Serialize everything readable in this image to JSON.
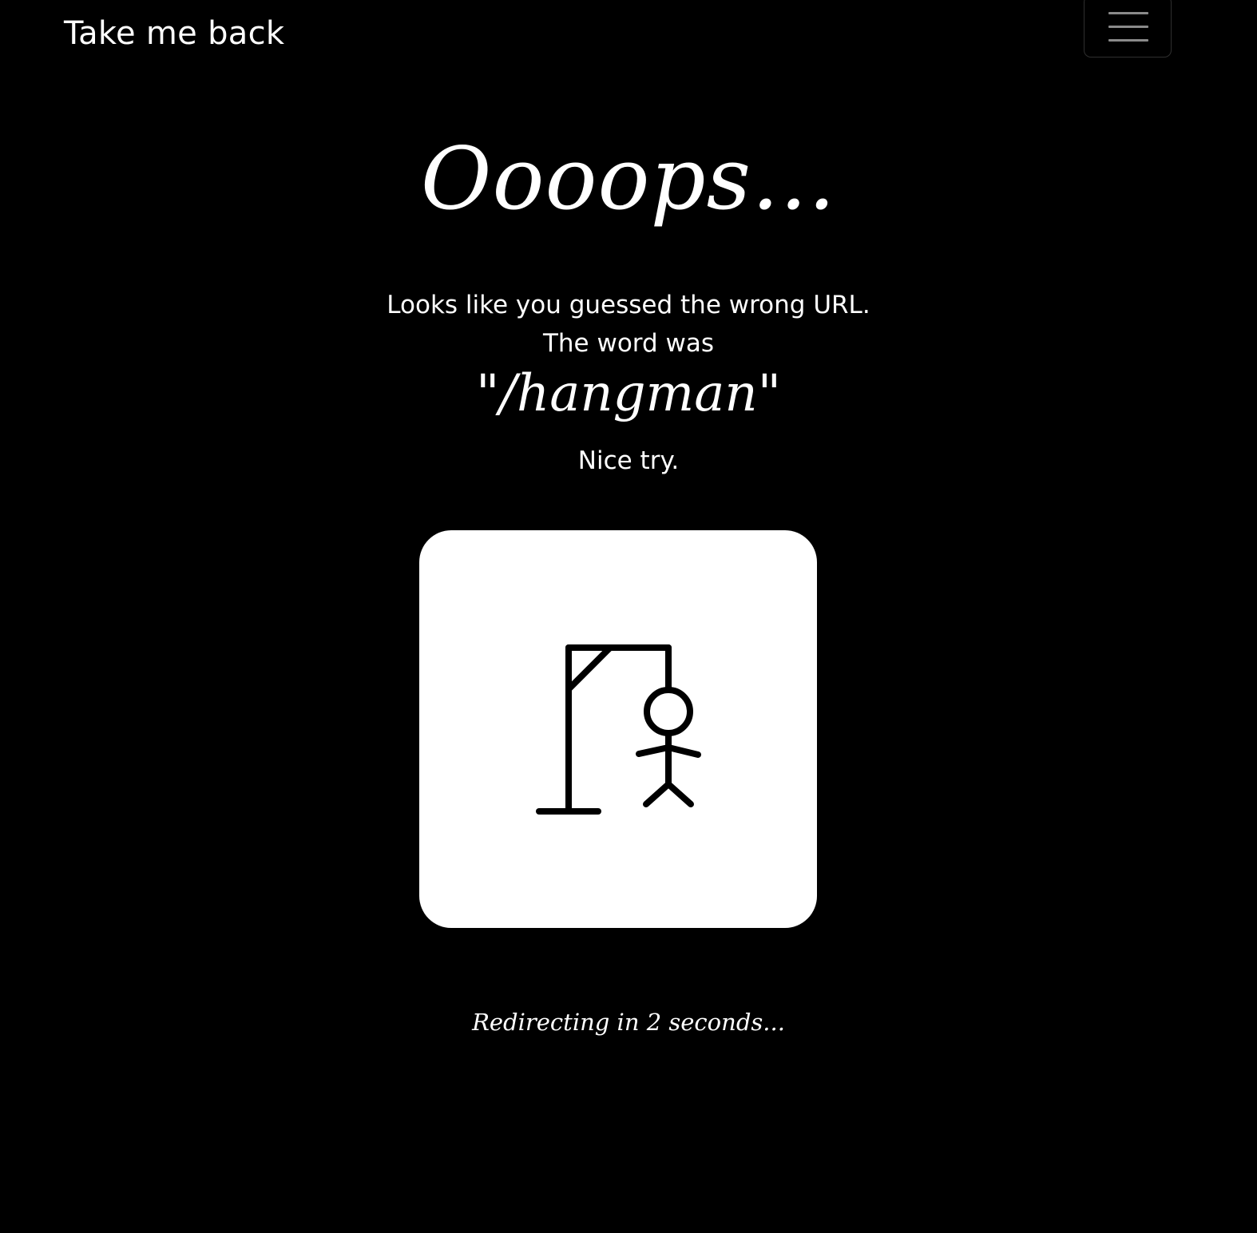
{
  "nav": {
    "brand": "Take me back",
    "toggler_icon": "hamburger-menu-icon"
  },
  "main": {
    "headline": "Oooops...",
    "line1": "Looks like you guessed the wrong URL.",
    "line2": "The word was",
    "word": "\"/hangman\"",
    "line3": "Nice try."
  },
  "illustration": {
    "icon": "hangman-icon"
  },
  "footer": {
    "redirect": "Redirecting in 2 seconds..."
  },
  "colors": {
    "background": "#000000",
    "text": "#ffffff",
    "card": "#ffffff",
    "drawing": "#000000"
  }
}
